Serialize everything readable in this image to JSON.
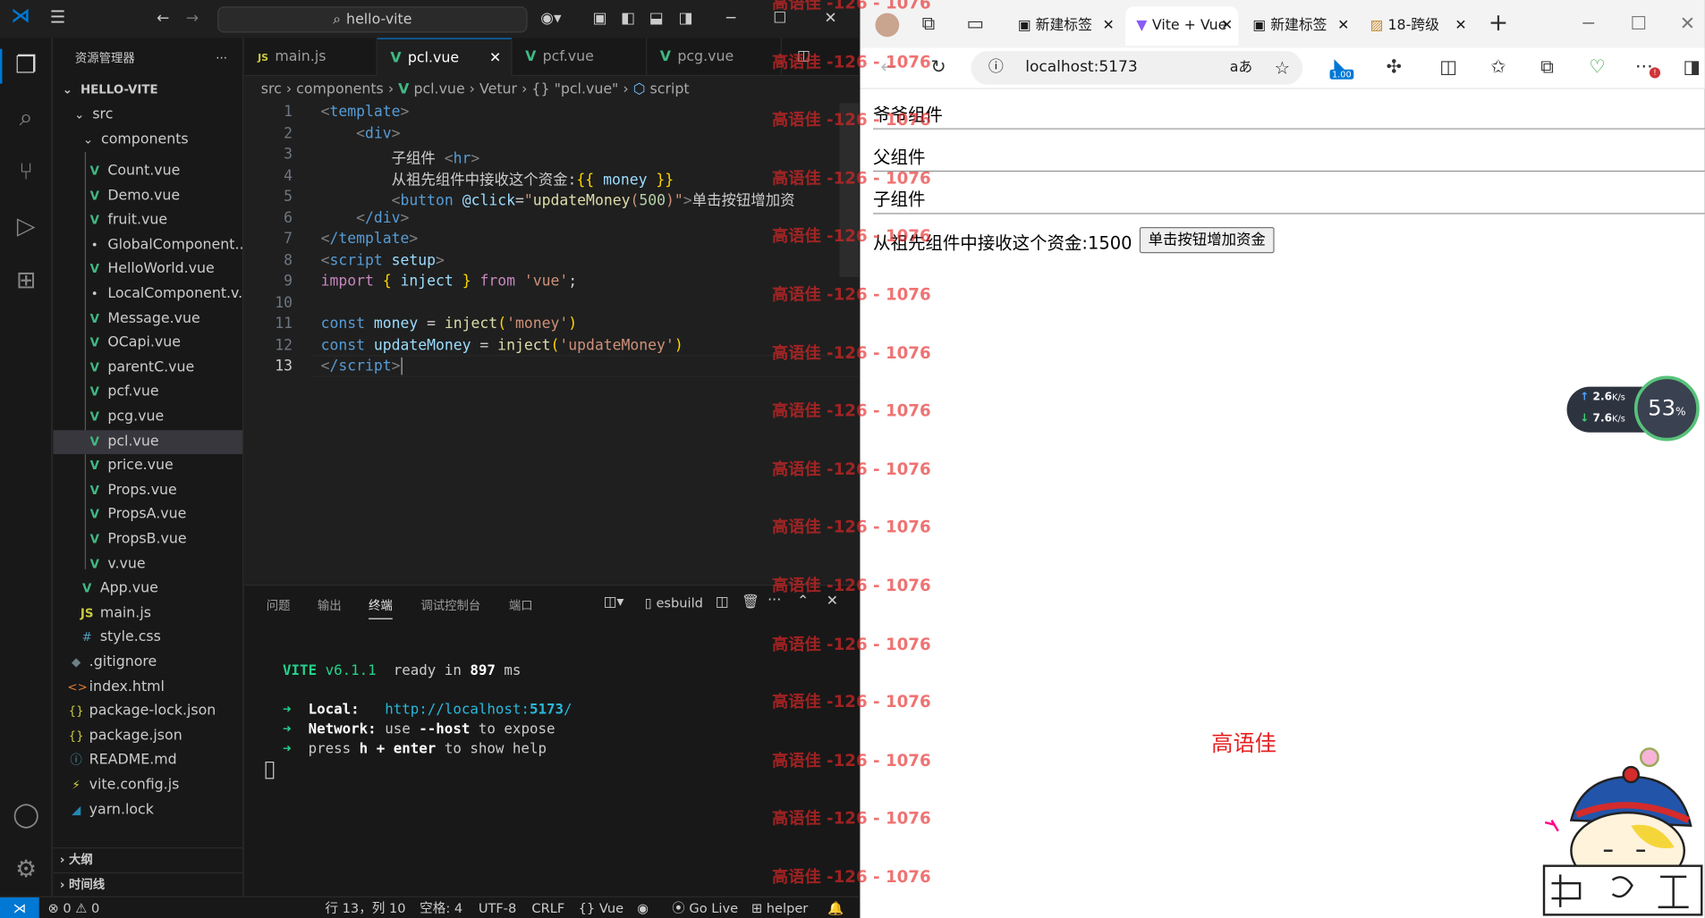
{
  "vscode": {
    "title": "hello-vite",
    "explorer_label": "资源管理器",
    "project": "HELLO-VITE",
    "tree": {
      "src": "src",
      "components": "components",
      "files_components": [
        "Count.vue",
        "Demo.vue",
        "fruit.vue",
        "GlobalComponent...",
        "HelloWorld.vue",
        "LocalComponent.v...",
        "Message.vue",
        "OCapi.vue",
        "parentC.vue",
        "pcf.vue",
        "pcg.vue",
        "pcl.vue",
        "price.vue",
        "Props.vue",
        "PropsA.vue",
        "PropsB.vue",
        "v.vue"
      ],
      "files_src": [
        "App.vue",
        "main.js",
        "style.css"
      ],
      "files_root": [
        ".gitignore",
        "index.html",
        "package-lock.json",
        "package.json",
        "README.md",
        "vite.config.js",
        "yarn.lock"
      ],
      "selected": "pcl.vue"
    },
    "outline_label": "大纲",
    "timeline_label": "时间线",
    "tabs": [
      "main.js",
      "pcl.vue",
      "pcf.vue",
      "pcg.vue"
    ],
    "active_tab": "pcl.vue",
    "breadcrumb": [
      "src",
      "components",
      "pcl.vue",
      "Vetur",
      "{} \"pcl.vue\"",
      "script"
    ],
    "line_numbers": [
      "1",
      "2",
      "3",
      "4",
      "5",
      "6",
      "7",
      "8",
      "9",
      "10",
      "11",
      "12",
      "13"
    ],
    "code": {
      "l1_tag": "template",
      "l2_tag": "div",
      "l3_text": "子组件",
      "l3_tag": "hr",
      "l4_text": "从祖先组件中接收这个资金:",
      "l4_var": "money",
      "l5_tag": "button",
      "l5_attr": "@click",
      "l5_fn": "updateMoney",
      "l5_num": "500",
      "l5_text": "单击按钮增加资",
      "l6_tag": "/div",
      "l7_tag": "/template",
      "l8_tag": "script",
      "l8_attr": "setup",
      "l9_import": "import",
      "l9_name": "inject",
      "l9_from": "from",
      "l9_mod": "'vue'",
      "l11_const": "const",
      "l11_var": "money",
      "l11_fn": "inject",
      "l11_arg": "'money'",
      "l12_const": "const",
      "l12_var": "updateMoney",
      "l12_fn": "inject",
      "l12_arg": "'updateMoney'",
      "l13_tag": "/script"
    },
    "panel_tabs": [
      "问题",
      "输出",
      "终端",
      "调试控制台",
      "端口"
    ],
    "active_panel_tab": "终端",
    "terminal_name": "esbuild",
    "terminal": {
      "vite": "VITE",
      "version": "v6.1.1",
      "ready": "ready in",
      "ms_num": "897",
      "ms": "ms",
      "local_label": "Local:",
      "local_url_a": "http://localhost:",
      "local_url_port": "5173",
      "local_url_b": "/",
      "network_label": "Network:",
      "network_a": "use",
      "network_host": "--host",
      "network_b": "to expose",
      "help_a": "press",
      "help_h": "h + enter",
      "help_b": "to show help"
    },
    "status": {
      "errors": "0",
      "warnings": "0",
      "position": "行 13，列 10",
      "spaces": "空格: 4",
      "encoding": "UTF-8",
      "eol": "CRLF",
      "language": "Vue",
      "golive": "Go Live",
      "helper": "helper"
    }
  },
  "browser": {
    "tabs": [
      "新建标签",
      "Vite + Vue",
      "新建标签",
      "18-跨级"
    ],
    "address": "localhost:5173",
    "zoom_badge": "1.00",
    "content": {
      "grandparent": "爷爷组件",
      "parent": "父组件",
      "child": "子组件",
      "money_label": "从祖先组件中接收这个资金:",
      "money_value": "1500",
      "button": "单击按钮增加资金",
      "name": "高语佳"
    }
  },
  "overlay": {
    "watermark": "高语佳 -126 - 1076",
    "net_up": "2.6",
    "net_down": "7.6",
    "net_unit": "K/s",
    "cpu_percent": "53",
    "cpu_unit": "%"
  }
}
